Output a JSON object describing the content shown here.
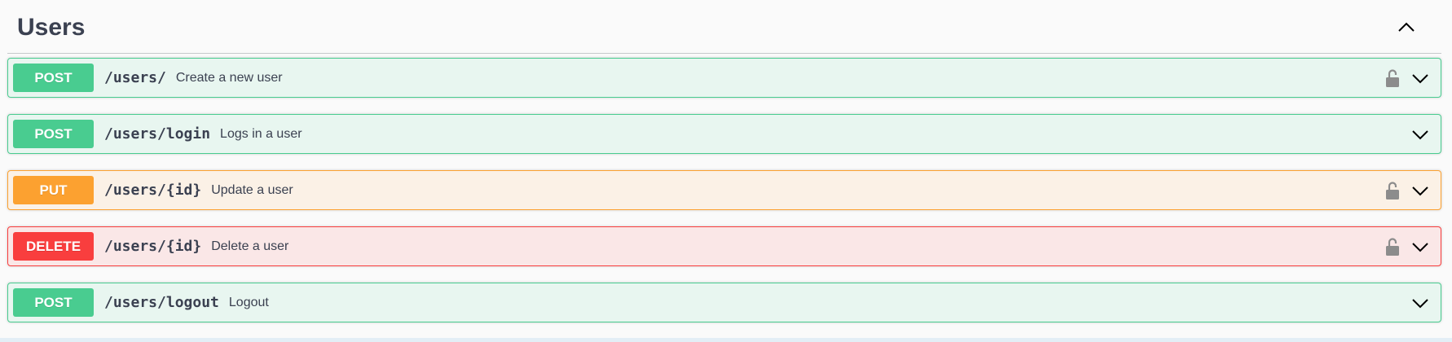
{
  "section": {
    "title": "Users",
    "collapse_icon": "chevron-up-icon"
  },
  "operations": [
    {
      "method": "POST",
      "path": "/users/",
      "summary": "Create a new user",
      "locked": true
    },
    {
      "method": "POST",
      "path": "/users/login",
      "summary": "Logs in a user",
      "locked": false
    },
    {
      "method": "PUT",
      "path": "/users/{id}",
      "summary": "Update a user",
      "locked": true
    },
    {
      "method": "DELETE",
      "path": "/users/{id}",
      "summary": "Delete a user",
      "locked": true
    },
    {
      "method": "POST",
      "path": "/users/logout",
      "summary": "Logout",
      "locked": false
    }
  ],
  "colors": {
    "post": "#49cc90",
    "put": "#fca130",
    "delete": "#f93e3e",
    "lock": "#8c8c8c",
    "text": "#3b4151"
  }
}
